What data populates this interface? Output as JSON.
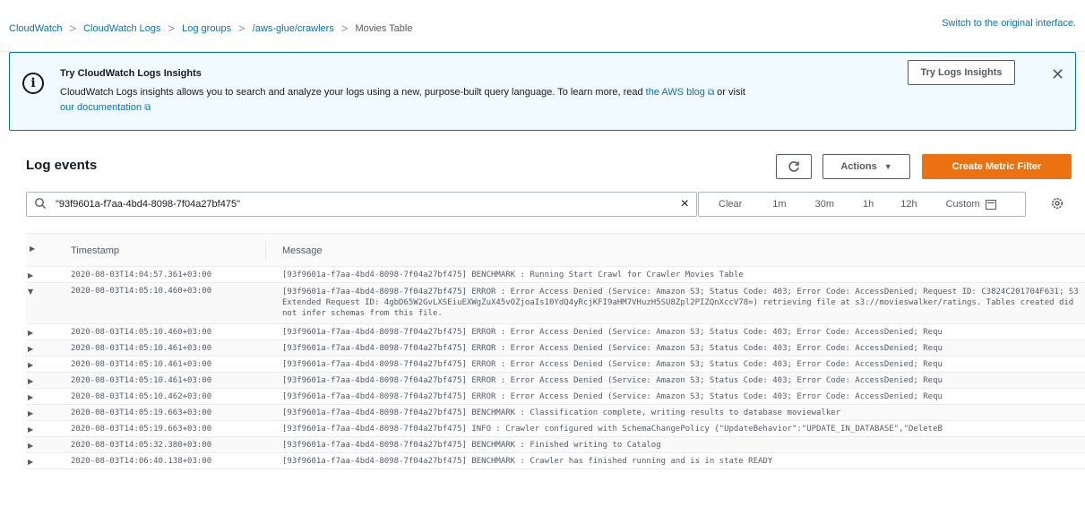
{
  "breadcrumb": {
    "items": [
      "CloudWatch",
      "CloudWatch Logs",
      "Log groups",
      "/aws-glue/crawlers"
    ],
    "current": "Movies Table",
    "separator": ">"
  },
  "switch_link": "Switch to the original interface.",
  "banner": {
    "icon": "info-icon",
    "title": "Try CloudWatch Logs Insights",
    "body_text": "CloudWatch Logs insights allows you to search and analyze your logs using a new, purpose-built query language. To learn more, read ",
    "blog_link": "the AWS blog",
    "or_text": " or visit",
    "docs_link": "our documentation",
    "button_label": "Try Logs Insights",
    "close_icon": "close-icon"
  },
  "panel": {
    "title": "Log events",
    "refresh_icon": "refresh-icon",
    "actions_label": "Actions",
    "create_label": "Create Metric Filter"
  },
  "filter": {
    "search_value": "\"93f9601a-f7aa-4bd4-8098-7f04a27bf475\"",
    "clear_icon": "×",
    "time_options": [
      "Clear",
      "1m",
      "30m",
      "1h",
      "12h",
      "Custom"
    ]
  },
  "table": {
    "columns": [
      "Timestamp",
      "Message"
    ],
    "rows": [
      {
        "expanded": false,
        "timestamp": "2020-08-03T14:04:57.361+03:00",
        "message": "[93f9601a-f7aa-4bd4-8098-7f04a27bf475] BENCHMARK : Running Start Crawl for Crawler Movies Table"
      },
      {
        "expanded": true,
        "timestamp": "2020-08-03T14:05:10.460+03:00",
        "message": "[93f9601a-f7aa-4bd4-8098-7f04a27bf475] ERROR : Error Access Denied (Service: Amazon S3; Status Code: 403; Error Code: AccessDenied; Request ID: C3824C201704F631; S3 Extended Request ID: 4gbD65W2GvLXSEiuEXWgZuX45vOZjoaIs10YdQ4yRcjKFI9aHM7VHuzH5SU8Zpl2PIZQnXccV78=) retrieving file at s3://movieswalker/ratings. Tables created did not infer schemas from this file."
      },
      {
        "expanded": false,
        "timestamp": "2020-08-03T14:05:10.460+03:00",
        "message": "[93f9601a-f7aa-4bd4-8098-7f04a27bf475] ERROR : Error Access Denied (Service: Amazon S3; Status Code: 403; Error Code: AccessDenied; Requ"
      },
      {
        "expanded": false,
        "timestamp": "2020-08-03T14:05:10.461+03:00",
        "message": "[93f9601a-f7aa-4bd4-8098-7f04a27bf475] ERROR : Error Access Denied (Service: Amazon S3; Status Code: 403; Error Code: AccessDenied; Requ"
      },
      {
        "expanded": false,
        "timestamp": "2020-08-03T14:05:10.461+03:00",
        "message": "[93f9601a-f7aa-4bd4-8098-7f04a27bf475] ERROR : Error Access Denied (Service: Amazon S3; Status Code: 403; Error Code: AccessDenied; Requ"
      },
      {
        "expanded": false,
        "timestamp": "2020-08-03T14:05:10.461+03:00",
        "message": "[93f9601a-f7aa-4bd4-8098-7f04a27bf475] ERROR : Error Access Denied (Service: Amazon S3; Status Code: 403; Error Code: AccessDenied; Requ"
      },
      {
        "expanded": false,
        "timestamp": "2020-08-03T14:05:10.462+03:00",
        "message": "[93f9601a-f7aa-4bd4-8098-7f04a27bf475] ERROR : Error Access Denied (Service: Amazon S3; Status Code: 403; Error Code: AccessDenied; Requ"
      },
      {
        "expanded": false,
        "timestamp": "2020-08-03T14:05:19.663+03:00",
        "message": "[93f9601a-f7aa-4bd4-8098-7f04a27bf475] BENCHMARK : Classification complete, writing results to database moviewalker"
      },
      {
        "expanded": false,
        "timestamp": "2020-08-03T14:05:19.663+03:00",
        "message": "[93f9601a-f7aa-4bd4-8098-7f04a27bf475] INFO : Crawler configured with SchemaChangePolicy {\"UpdateBehavior\":\"UPDATE_IN_DATABASE\",\"DeleteB"
      },
      {
        "expanded": false,
        "timestamp": "2020-08-03T14:05:32.380+03:00",
        "message": "[93f9601a-f7aa-4bd4-8098-7f04a27bf475] BENCHMARK : Finished writing to Catalog"
      },
      {
        "expanded": false,
        "timestamp": "2020-08-03T14:06:40.138+03:00",
        "message": "[93f9601a-f7aa-4bd4-8098-7f04a27bf475] BENCHMARK : Crawler has finished running and is in state READY"
      }
    ]
  },
  "colors": {
    "link": "#0073bb",
    "primary_button": "#ec7211",
    "banner_bg": "#f1faff",
    "banner_border": "#0073bb"
  }
}
